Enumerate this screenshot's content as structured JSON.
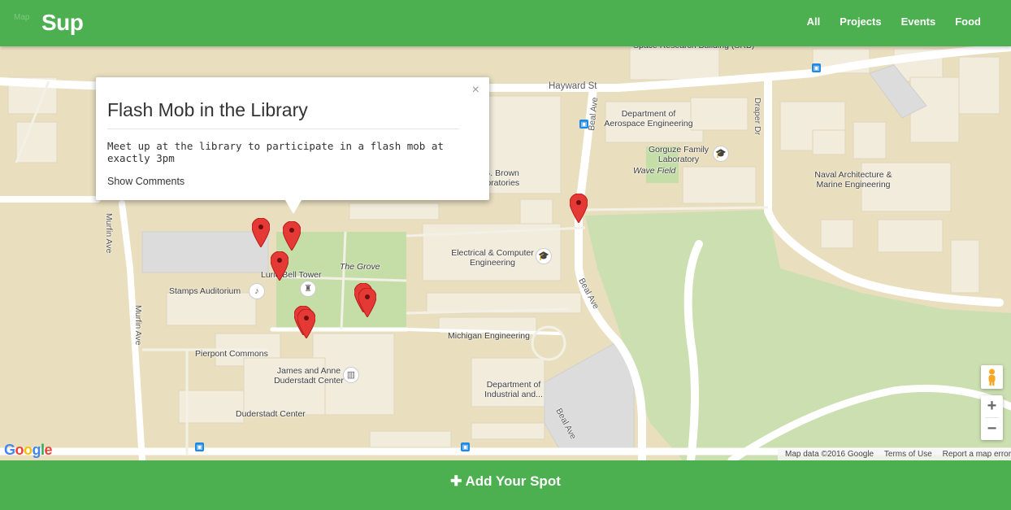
{
  "header": {
    "brand": "Sup",
    "map_tab": "Map",
    "nav": [
      "All",
      "Projects",
      "Events",
      "Food"
    ]
  },
  "map": {
    "labels": {
      "space_research": "Space Research Building (SRB)",
      "hayward": "Hayward St",
      "aerospace": "Department of Aerospace Engineering",
      "gorguze": "Gorguze Family Laboratory",
      "wave_field": "Wave Field",
      "draper": "Draper Dr",
      "naval": "Naval Architecture & Marine Engineering",
      "brown": "G. G. Brown Laboratories",
      "electrical": "Electrical & Computer Engineering",
      "grove": "The Grove",
      "lurie": "Lurie Bell Tower",
      "stamps": "Stamps Auditorium",
      "pierpont": "Pierpont Commons",
      "duderstadt_center_full": "James and Anne Duderstadt Center",
      "duderstadt": "Duderstadt Center",
      "michigan_eng": "Michigan Engineering",
      "industrial": "Department of Industrial and...",
      "murfin": "Murfin Ave",
      "beal": "Beal Ave"
    },
    "attribution": [
      "Map data ©2016 Google",
      "Terms of Use",
      "Report a map error"
    ],
    "google_logo": "Google"
  },
  "popup": {
    "title": "Flash Mob in the Library",
    "description": "Meet up at the library to participate in a flash mob at exactly 3pm",
    "show_comments": "Show Comments",
    "close": "×"
  },
  "controls": {
    "zoom_in": "+",
    "zoom_out": "−"
  },
  "footer": {
    "add_spot": "✚ Add Your Spot"
  },
  "colors": {
    "brand_green": "#4caf50",
    "marker_red": "#e53935"
  }
}
